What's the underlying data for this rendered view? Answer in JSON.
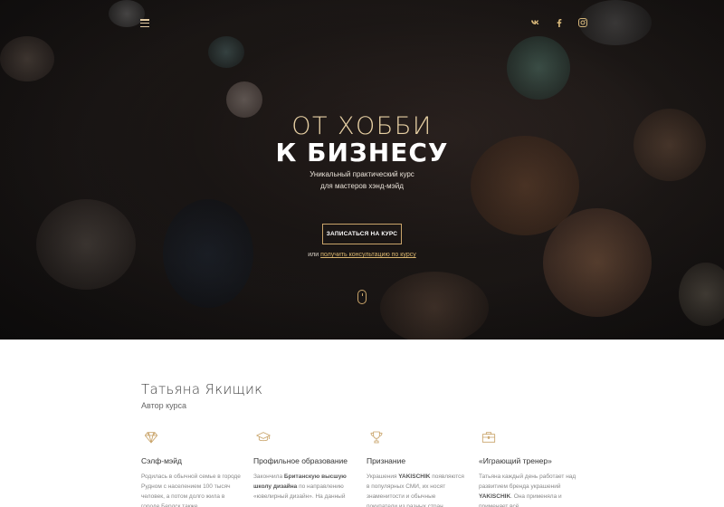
{
  "header": {
    "menu_icon": "hamburger-icon",
    "socials": [
      {
        "icon": "vk-icon"
      },
      {
        "icon": "facebook-icon"
      },
      {
        "icon": "instagram-icon"
      }
    ]
  },
  "hero": {
    "title_line1": "ОТ ХОББИ",
    "title_line2": "К БИЗНЕСУ",
    "subtitle_line1": "Уникальный практический курс",
    "subtitle_line2": "для мастеров хэнд-мэйд",
    "cta_label": "ЗАПИСАТЬСЯ НА КУРС",
    "consult_prefix": "или",
    "consult_link": "получить консультацию по курсу",
    "scroll_icon": "mouse-scroll-icon"
  },
  "author": {
    "name": "Татьяна Якищик",
    "role": "Автор курса"
  },
  "features": [
    {
      "icon": "diamond-icon",
      "title": "Сэлф-мэйд",
      "text": "Родилась в обычной семье в городе Рудном с населением 100 тысяч человек, а потом долго жила в городе Бердск также"
    },
    {
      "icon": "graduation-cap-icon",
      "title": "Профильное образование",
      "text_parts": [
        "Закончила ",
        "Британскую высшую школу дизайна",
        " по направлению «ювелирный дизайн». На данный"
      ]
    },
    {
      "icon": "trophy-icon",
      "title": "Признание",
      "text_parts": [
        "Украшения ",
        "YAKISCHIK",
        " появляются в популярных СМИ, их носят знаменитости и обычные покупатели из разных стран"
      ]
    },
    {
      "icon": "briefcase-icon",
      "title": "«Играющий тренер»",
      "text_parts": [
        "Татьяна каждый день работает над развитием бренда украшений ",
        "YAKISCHIK",
        ". Она применяла и применяет всё,"
      ]
    }
  ],
  "colors": {
    "accent_gold": "#c9a46a",
    "hero_title_gold": "#e6cfa3",
    "hero_bg": "#1f1a18"
  }
}
